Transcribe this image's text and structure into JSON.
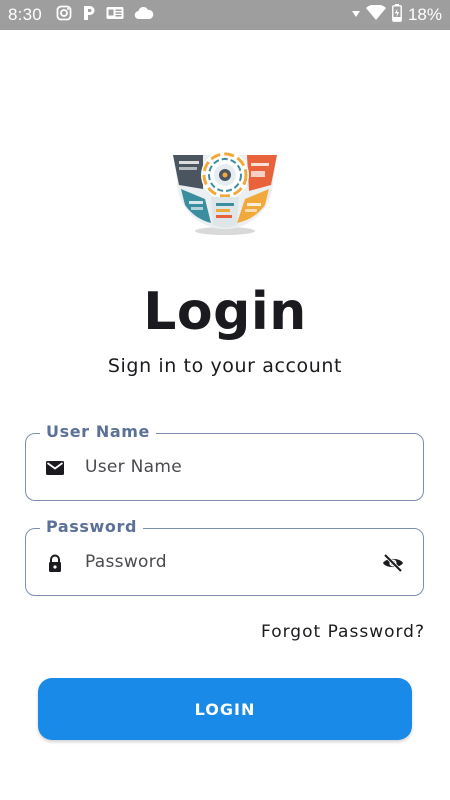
{
  "status_bar": {
    "time": "8:30",
    "battery_percent": "18%",
    "icons": [
      "instagram-icon",
      "pandora-icon",
      "news-icon",
      "cloud-icon",
      "signal-arrow-icon",
      "wifi-icon",
      "battery-charging-icon"
    ]
  },
  "logo": {
    "icon": "app-logo-icon"
  },
  "header": {
    "title": "Login",
    "subtitle": "Sign in to your account"
  },
  "form": {
    "username": {
      "label": "User Name",
      "placeholder": "User Name",
      "value": "",
      "icon": "mail-icon"
    },
    "password": {
      "label": "Password",
      "placeholder": "Password",
      "value": "",
      "icon": "lock-icon",
      "toggle_icon": "eye-off-icon"
    },
    "forgot_label": "Forgot Password?",
    "submit_label": "LOGIN"
  },
  "colors": {
    "accent": "#1a8ae8",
    "field_border": "#7d8fb0",
    "field_label": "#5c7198",
    "status_bar": "#9e9e9e",
    "text": "#1b1b1f"
  }
}
